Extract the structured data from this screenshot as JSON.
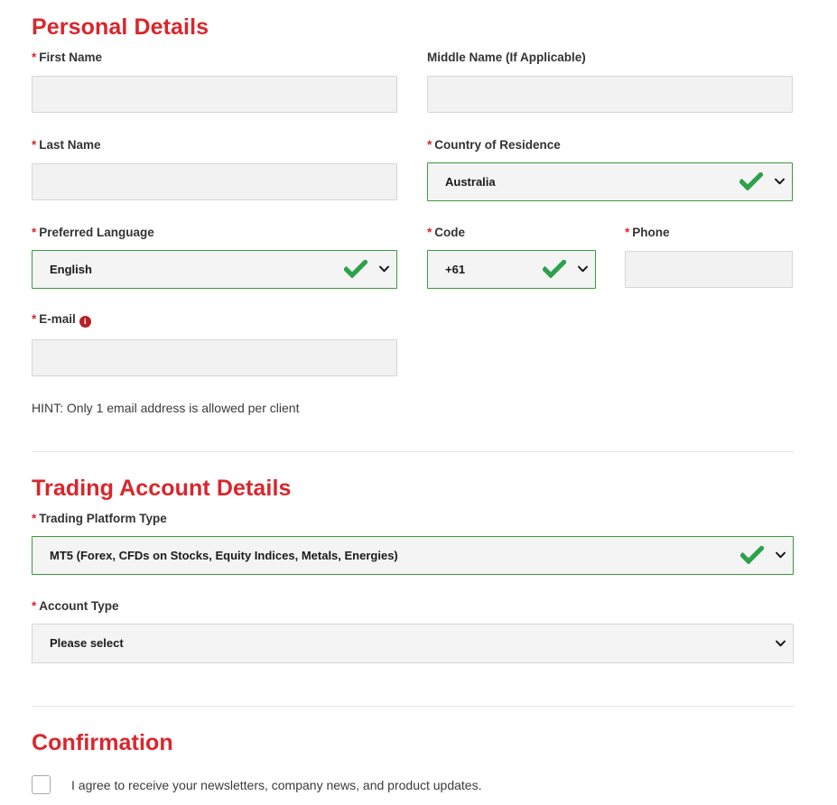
{
  "theme": {
    "heading_red": "#d9262c",
    "valid_green": "#3b9b3b",
    "check_green": "#2ea14c",
    "input_bg": "#f2f2f2",
    "input_border": "#d6d6d6",
    "label_color": "#333333",
    "divider_color": "#e3e3e3"
  },
  "sections": {
    "personal": {
      "title": "Personal Details",
      "fields": {
        "first_name": {
          "label": "First Name",
          "required": true,
          "value": "",
          "placeholder": ""
        },
        "middle_name": {
          "label": "Middle Name (If Applicable)",
          "required": false,
          "value": "",
          "placeholder": ""
        },
        "last_name": {
          "label": "Last Name",
          "required": true,
          "value": "",
          "placeholder": ""
        },
        "country": {
          "label": "Country of Residence",
          "required": true,
          "value": "Australia",
          "valid": true
        },
        "language": {
          "label": "Preferred Language",
          "required": true,
          "value": "English",
          "valid": true
        },
        "code": {
          "label": "Code",
          "required": true,
          "value": "+61",
          "valid": true
        },
        "phone": {
          "label": "Phone",
          "required": true,
          "value": "",
          "placeholder": ""
        },
        "email": {
          "label": "E-mail",
          "required": true,
          "value": "",
          "placeholder": "",
          "info_icon": "info-icon"
        }
      },
      "hint": "HINT: Only 1 email address is allowed per client"
    },
    "trading": {
      "title": "Trading Account Details",
      "fields": {
        "platform_type": {
          "label": "Trading Platform Type",
          "required": true,
          "value": "MT5 (Forex, CFDs on Stocks, Equity Indices, Metals, Energies)",
          "valid": true
        },
        "account_type": {
          "label": "Account Type",
          "required": true,
          "value": "Please select",
          "valid": false
        }
      }
    },
    "confirmation": {
      "title": "Confirmation",
      "newsletter": {
        "label": "I agree to receive your newsletters, company news, and product updates.",
        "checked": false
      }
    }
  },
  "icons": {
    "required_star": "*",
    "info": "i",
    "chevron_down": "chevron-down-icon",
    "check": "check-icon"
  }
}
